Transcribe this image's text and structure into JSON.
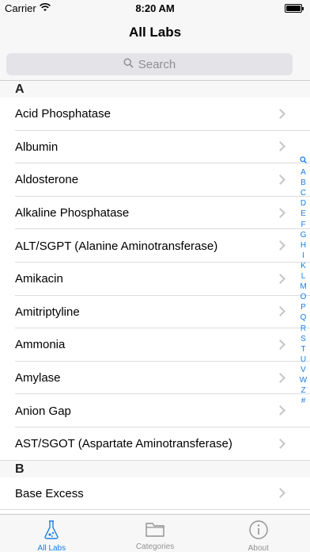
{
  "status_bar": {
    "carrier": "Carrier",
    "time": "8:20 AM"
  },
  "nav": {
    "title": "All Labs"
  },
  "search": {
    "placeholder": "Search"
  },
  "sections": [
    {
      "letter": "A",
      "items": [
        "Acid Phosphatase",
        "Albumin",
        "Aldosterone",
        "Alkaline Phosphatase",
        "ALT/SGPT (Alanine Aminotransferase)",
        "Amikacin",
        "Amitriptyline",
        "Ammonia",
        "Amylase",
        "Anion Gap",
        "AST/SGOT (Aspartate Aminotransferase)"
      ]
    },
    {
      "letter": "B",
      "items": [
        "Base Excess"
      ]
    }
  ],
  "index_letters": [
    "A",
    "B",
    "C",
    "D",
    "E",
    "F",
    "G",
    "H",
    "I",
    "K",
    "L",
    "M",
    "O",
    "P",
    "Q",
    "R",
    "S",
    "T",
    "U",
    "V",
    "W",
    "Z",
    "#"
  ],
  "tabs": [
    {
      "label": "All Labs",
      "icon": "flask-icon",
      "active": true
    },
    {
      "label": "Categories",
      "icon": "folder-icon",
      "active": false
    },
    {
      "label": "About",
      "icon": "info-icon",
      "active": false
    }
  ],
  "colors": {
    "accent": "#1a7ee8",
    "bar_bg": "#f7f7f7",
    "separator": "#dcdce0"
  }
}
